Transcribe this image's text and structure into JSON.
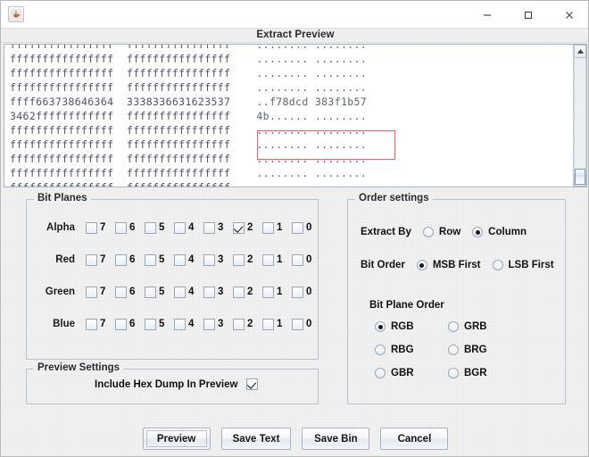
{
  "window": {
    "icon": "java-app-icon",
    "minimize_label": "–",
    "maximize_label": "□",
    "close_label": "✕"
  },
  "dialog": {
    "caption": "Extract Preview"
  },
  "hex_preview": {
    "highlight_color": "#f06060",
    "rows": [
      {
        "g1": "ffffffffffffffff",
        "g2": "ffffffffffffffff",
        "ascii": "........ ........"
      },
      {
        "g1": "ffffffffffffffff",
        "g2": "ffffffffffffffff",
        "ascii": "........ ........"
      },
      {
        "g1": "ffffffffffffffff",
        "g2": "ffffffffffffffff",
        "ascii": "........ ........"
      },
      {
        "g1": "ffffffffffffffff",
        "g2": "ffffffffffffffff",
        "ascii": "........ ........"
      },
      {
        "g1": "ffff663738646364",
        "g2": "3338336631623537",
        "ascii": "..f78dcd 383f1b57"
      },
      {
        "g1": "3462ffffffffffff",
        "g2": "ffffffffffffffff",
        "ascii": "4b...... ........"
      },
      {
        "g1": "ffffffffffffffff",
        "g2": "ffffffffffffffff",
        "ascii": "........ ........"
      },
      {
        "g1": "ffffffffffffffff",
        "g2": "ffffffffffffffff",
        "ascii": "........ ........"
      },
      {
        "g1": "ffffffffffffffff",
        "g2": "ffffffffffffffff",
        "ascii": "........ ........"
      },
      {
        "g1": "ffffffffffffffff",
        "g2": "ffffffffffffffff",
        "ascii": "........ ........"
      },
      {
        "g1": "ffffffffffffffff",
        "g2": "ffffffffffffffff",
        "ascii": "........ ........"
      }
    ]
  },
  "bit_planes": {
    "title": "Bit Planes",
    "bit_labels": [
      "7",
      "6",
      "5",
      "4",
      "3",
      "2",
      "1",
      "0"
    ],
    "channels": [
      {
        "label": "Alpha",
        "checked": [
          false,
          false,
          false,
          false,
          false,
          true,
          false,
          false
        ]
      },
      {
        "label": "Red",
        "checked": [
          false,
          false,
          false,
          false,
          false,
          false,
          false,
          false
        ]
      },
      {
        "label": "Green",
        "checked": [
          false,
          false,
          false,
          false,
          false,
          false,
          false,
          false
        ]
      },
      {
        "label": "Blue",
        "checked": [
          false,
          false,
          false,
          false,
          false,
          false,
          false,
          false
        ]
      }
    ]
  },
  "preview_settings": {
    "title": "Preview Settings",
    "include_hex_dump_label": "Include Hex Dump In Preview",
    "include_hex_dump_checked": true
  },
  "order_settings": {
    "title": "Order settings",
    "extract_by": {
      "label": "Extract By",
      "options": [
        "Row",
        "Column"
      ],
      "selected": "Column"
    },
    "bit_order": {
      "label": "Bit Order",
      "options": [
        "MSB First",
        "LSB First"
      ],
      "selected": "MSB First"
    },
    "bit_plane_order": {
      "label": "Bit Plane Order",
      "options": [
        "RGB",
        "GRB",
        "RBG",
        "BRG",
        "GBR",
        "BGR"
      ],
      "selected": "RGB"
    }
  },
  "buttons": [
    {
      "label": "Preview",
      "focused": true
    },
    {
      "label": "Save Text",
      "focused": false
    },
    {
      "label": "Save Bin",
      "focused": false
    },
    {
      "label": "Cancel",
      "focused": false
    }
  ]
}
